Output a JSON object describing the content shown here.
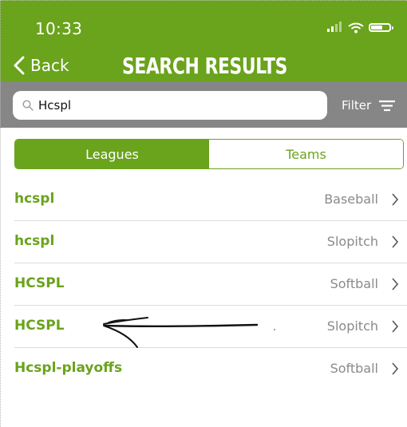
{
  "status_bar": {
    "time": "10:33"
  },
  "nav": {
    "back_label": "Back",
    "title": "SEARCH RESULTS"
  },
  "search": {
    "query": "Hcspl",
    "filter_label": "Filter"
  },
  "tabs": [
    {
      "label": "Leagues",
      "active": true
    },
    {
      "label": "Teams",
      "active": false
    }
  ],
  "results": [
    {
      "name": "hcspl",
      "sport": "Baseball"
    },
    {
      "name": "hcspl",
      "sport": "Slopitch"
    },
    {
      "name": "HCSPL",
      "sport": "Softball"
    },
    {
      "name": "HCSPL",
      "sport": "Slopitch"
    },
    {
      "name": "Hcspl-playoffs",
      "sport": "Softball"
    }
  ],
  "colors": {
    "accent": "#6aa31c",
    "search_bar_bg": "#868686",
    "secondary_text": "#8a8a8a"
  },
  "icons": [
    "signal-icon",
    "wifi-icon",
    "battery-icon",
    "back-chevron-icon",
    "search-icon",
    "filter-icon",
    "chevron-right-icon"
  ]
}
